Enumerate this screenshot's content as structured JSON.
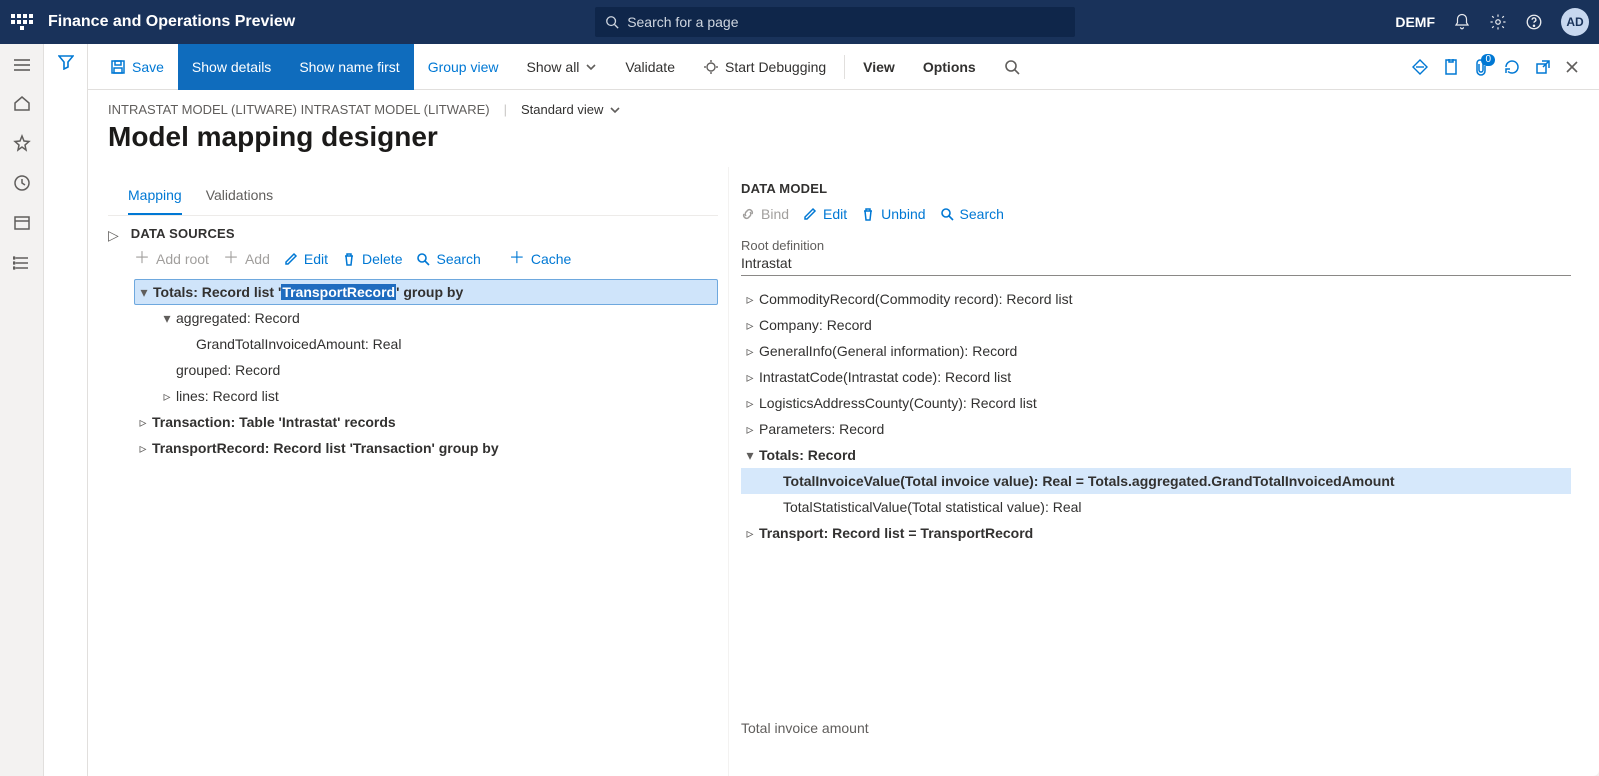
{
  "topbar": {
    "app_name": "Finance and Operations Preview",
    "search_placeholder": "Search for a page",
    "company": "DEMF",
    "avatar_initials": "AD"
  },
  "actionbar": {
    "save": "Save",
    "show_details": "Show details",
    "show_name_first": "Show name first",
    "group_view": "Group view",
    "show_all": "Show all",
    "validate": "Validate",
    "start_debugging": "Start Debugging",
    "view": "View",
    "options": "Options",
    "badge_count": "0"
  },
  "breadcrumb": {
    "path1": "INTRASTAT MODEL (LITWARE) INTRASTAT MODEL (LITWARE)",
    "view_name": "Standard view"
  },
  "page_title": "Model mapping designer",
  "tabs": {
    "mapping": "Mapping",
    "validations": "Validations"
  },
  "datasources": {
    "heading": "DATA SOURCES",
    "toolbar": {
      "add_root": "Add root",
      "add": "Add",
      "edit": "Edit",
      "delete": "Delete",
      "search": "Search",
      "cache": "Cache"
    },
    "tree": {
      "totals_pre": "Totals: Record list '",
      "totals_hl": "TransportRecord",
      "totals_post": "' group by",
      "aggregated": "aggregated: Record",
      "grand_total": "GrandTotalInvoicedAmount: Real",
      "grouped": "grouped: Record",
      "lines": "lines: Record list",
      "transaction": "Transaction: Table 'Intrastat' records",
      "transport": "TransportRecord: Record list 'Transaction' group by"
    }
  },
  "datamodel": {
    "heading": "DATA MODEL",
    "toolbar": {
      "bind": "Bind",
      "edit": "Edit",
      "unbind": "Unbind",
      "search": "Search"
    },
    "root_label": "Root definition",
    "root_value": "Intrastat",
    "items": {
      "commodity": "CommodityRecord(Commodity record): Record list",
      "company": "Company: Record",
      "general": "GeneralInfo(General information): Record",
      "intrastat_code": "IntrastatCode(Intrastat code): Record list",
      "logistics": "LogisticsAddressCounty(County): Record list",
      "parameters": "Parameters: Record",
      "totals": "Totals: Record",
      "total_invoice": "TotalInvoiceValue(Total invoice value): Real = Totals.aggregated.GrandTotalInvoicedAmount",
      "total_stat": "TotalStatisticalValue(Total statistical value): Real",
      "transport": "Transport: Record list = TransportRecord"
    },
    "footer": "Total invoice amount"
  }
}
